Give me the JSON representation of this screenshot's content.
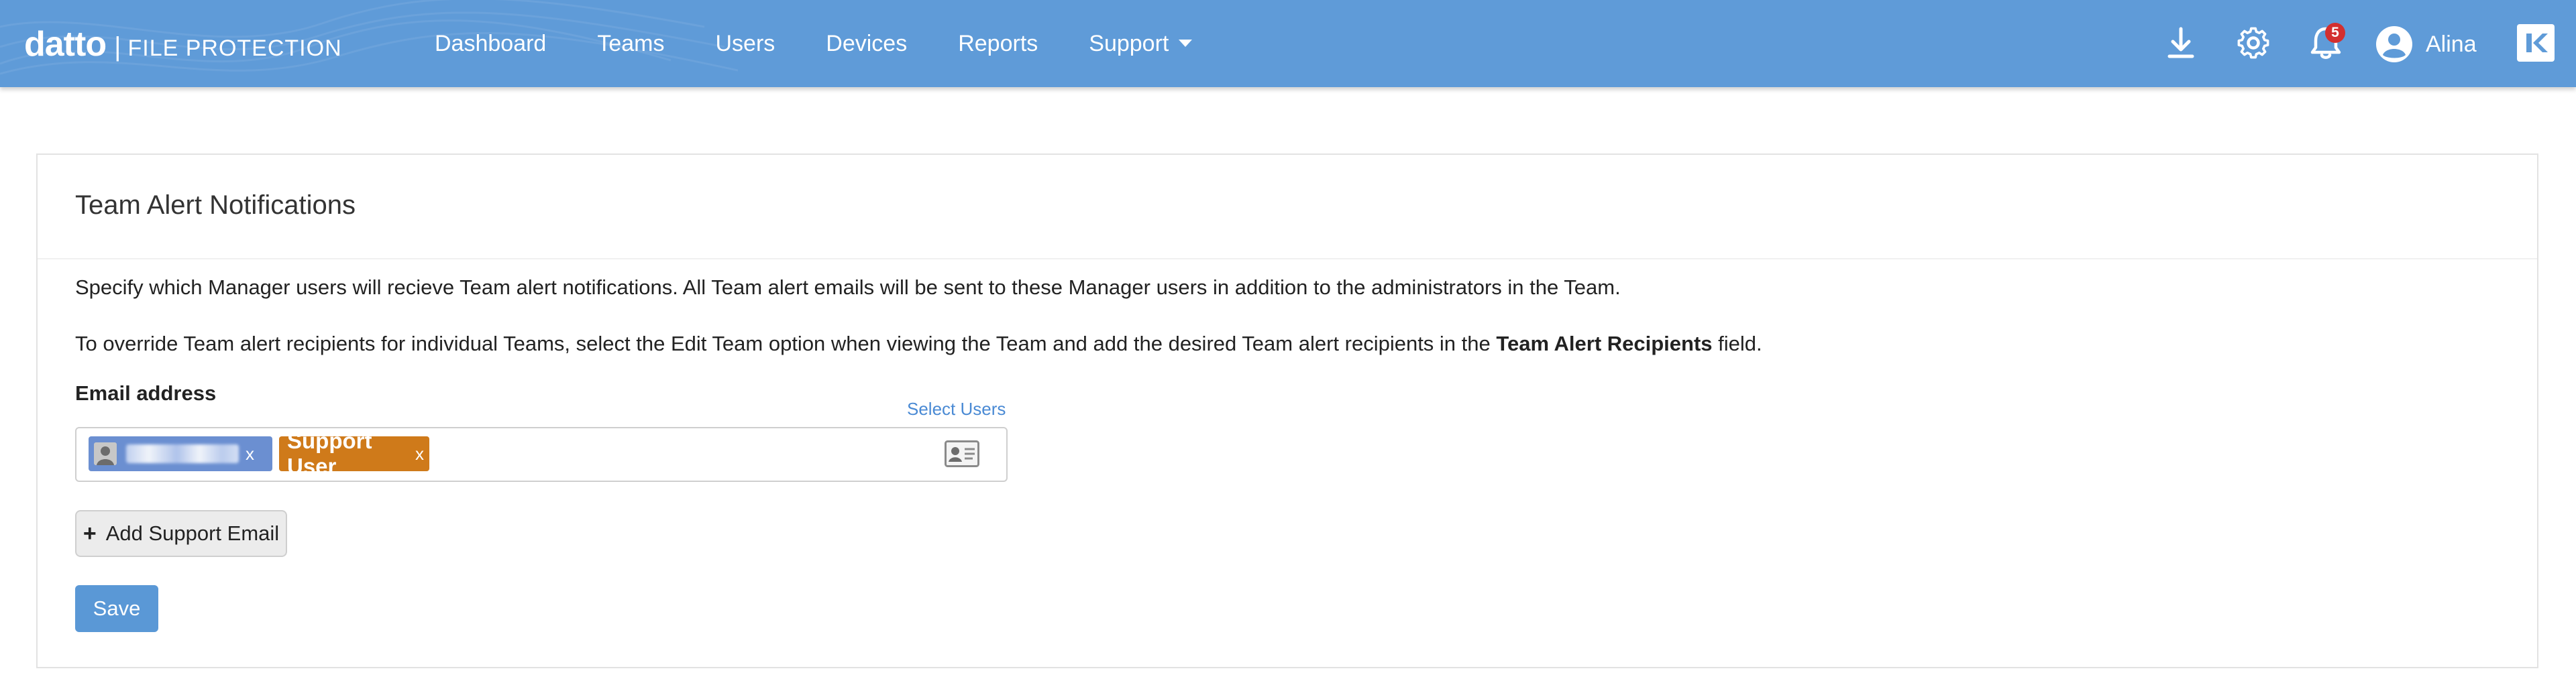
{
  "brand": {
    "name": "datto",
    "separator": "|",
    "product": "FILE PROTECTION"
  },
  "nav": {
    "items": [
      {
        "label": "Dashboard"
      },
      {
        "label": "Teams"
      },
      {
        "label": "Users"
      },
      {
        "label": "Devices"
      },
      {
        "label": "Reports"
      },
      {
        "label": "Support",
        "icon": "caret-down-icon"
      }
    ]
  },
  "toolbar": {
    "download_icon": "download-icon",
    "settings_icon": "gear-icon",
    "notifications_icon": "bell-icon",
    "notifications_count": "5",
    "user_icon": "user-circle-icon",
    "user_name": "Alina",
    "app_logo": "k-logo-icon"
  },
  "card": {
    "title": "Team Alert Notifications",
    "description_1": "Specify which Manager users will recieve Team alert notifications. All Team alert emails will be sent to these Manager users in addition to the administrators in the Team.",
    "description_2_prefix": "To override Team alert recipients for individual Teams, select the Edit Team option when viewing the Team and add the desired Team alert recipients in the ",
    "description_2_bold": "Team Alert Recipients",
    "description_2_suffix": " field.",
    "email_label": "Email address",
    "select_users": "Select Users",
    "recipients": [
      {
        "type": "user",
        "label": "",
        "remove": "x",
        "color": "#6b8fd1",
        "redacted": true
      },
      {
        "type": "support",
        "label": "Support User",
        "remove": "x",
        "color": "#cf7a1a"
      }
    ],
    "contact_icon": "address-card-icon",
    "add_support_label": "Add Support Email",
    "add_support_icon": "+",
    "save_label": "Save"
  },
  "colors": {
    "topbar": "#5f9bd8",
    "save_button": "#5a98d6",
    "link": "#4a8ad4",
    "badge": "#d32f2f"
  }
}
